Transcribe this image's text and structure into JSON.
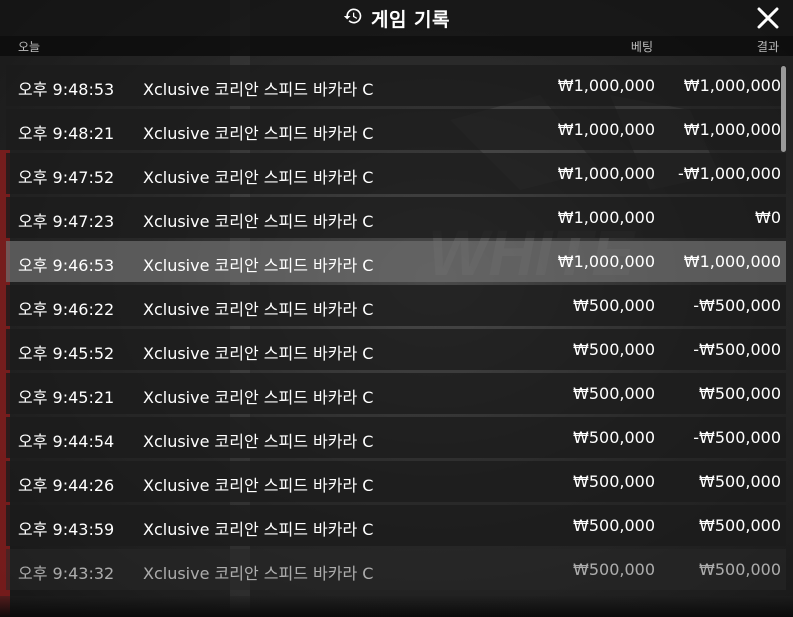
{
  "header": {
    "title": "게임 기록",
    "history_icon": "history-icon",
    "close_icon": "close-icon"
  },
  "columns": {
    "date": "오늘",
    "bet": "베팅",
    "result": "결과"
  },
  "rows": [
    {
      "time": "오후 9:48:53",
      "game": "Xclusive 코리안 스피드 바카라 C",
      "bet": "₩1,000,000",
      "result": "₩1,000,000"
    },
    {
      "time": "오후 9:48:21",
      "game": "Xclusive 코리안 스피드 바카라 C",
      "bet": "₩1,000,000",
      "result": "₩1,000,000"
    },
    {
      "time": "오후 9:47:52",
      "game": "Xclusive 코리안 스피드 바카라 C",
      "bet": "₩1,000,000",
      "result": "-₩1,000,000"
    },
    {
      "time": "오후 9:47:23",
      "game": "Xclusive 코리안 스피드 바카라 C",
      "bet": "₩1,000,000",
      "result": "₩0"
    },
    {
      "time": "오후 9:46:53",
      "game": "Xclusive 코리안 스피드 바카라 C",
      "bet": "₩1,000,000",
      "result": "₩1,000,000"
    },
    {
      "time": "오후 9:46:22",
      "game": "Xclusive 코리안 스피드 바카라 C",
      "bet": "₩500,000",
      "result": "-₩500,000"
    },
    {
      "time": "오후 9:45:52",
      "game": "Xclusive 코리안 스피드 바카라 C",
      "bet": "₩500,000",
      "result": "-₩500,000"
    },
    {
      "time": "오후 9:45:21",
      "game": "Xclusive 코리안 스피드 바카라 C",
      "bet": "₩500,000",
      "result": "₩500,000"
    },
    {
      "time": "오후 9:44:54",
      "game": "Xclusive 코리안 스피드 바카라 C",
      "bet": "₩500,000",
      "result": "-₩500,000"
    },
    {
      "time": "오후 9:44:26",
      "game": "Xclusive 코리안 스피드 바카라 C",
      "bet": "₩500,000",
      "result": "₩500,000"
    },
    {
      "time": "오후 9:43:59",
      "game": "Xclusive 코리안 스피드 바카라 C",
      "bet": "₩500,000",
      "result": "₩500,000"
    },
    {
      "time": "오후 9:43:32",
      "game": "Xclusive 코리안 스피드 바카라 C",
      "bet": "₩500,000",
      "result": "₩500,000"
    }
  ],
  "background_watermark": "WHITE",
  "colors": {
    "highlight_row": "#6e6e6e",
    "row_bg": "#1c1c1c",
    "text": "#ffffff"
  }
}
